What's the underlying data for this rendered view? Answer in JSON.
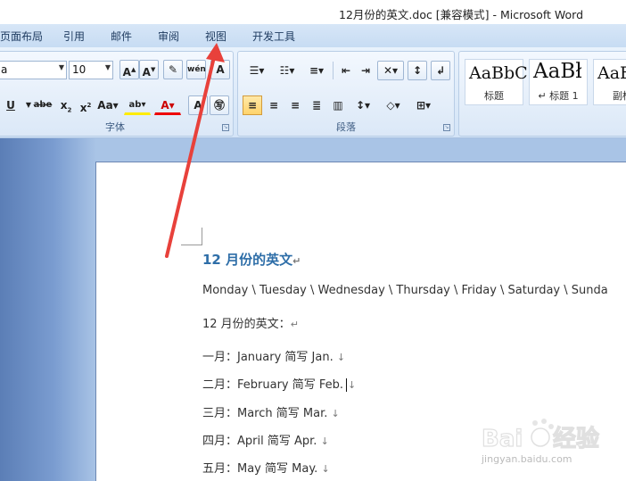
{
  "window": {
    "title": "12月份的英文.doc [兼容模式] - Microsoft Word"
  },
  "menu_tabs": [
    "页面布局",
    "引用",
    "邮件",
    "审阅",
    "视图",
    "开发工具"
  ],
  "font_group": {
    "font_name": "a",
    "font_size": "10",
    "label": "字体"
  },
  "paragraph_group": {
    "label": "段落"
  },
  "styles": [
    {
      "sample": "AaBbC",
      "caption": "标题"
    },
    {
      "sample": "AaBł",
      "caption": "↵ 标题 1"
    },
    {
      "sample": "AaE",
      "caption": "副标"
    }
  ],
  "document": {
    "heading": "12 月份的英文",
    "heading_mark": "↵",
    "days_line": "Monday \\ Tuesday \\ Wednesday \\ Thursday \\ Friday \\ Saturday \\ Sunda",
    "intro": "12 月份的英文：",
    "intro_mark": "↵",
    "months": [
      {
        "text": "一月：January  简写 Jan.",
        "mark": "↓"
      },
      {
        "text": "二月：February  简写 Feb.",
        "mark": "↓"
      },
      {
        "text": "三月：March  简写 Mar.",
        "mark": "↓"
      },
      {
        "text": "四月：April  简写 Apr.",
        "mark": "↓"
      },
      {
        "text": "五月：May  简写 May.",
        "mark": "↓"
      }
    ]
  },
  "watermark": {
    "text": "jingyan.baidu.com"
  },
  "colors": {
    "arrow": "#e8413b",
    "heading": "#2e6ea8"
  }
}
